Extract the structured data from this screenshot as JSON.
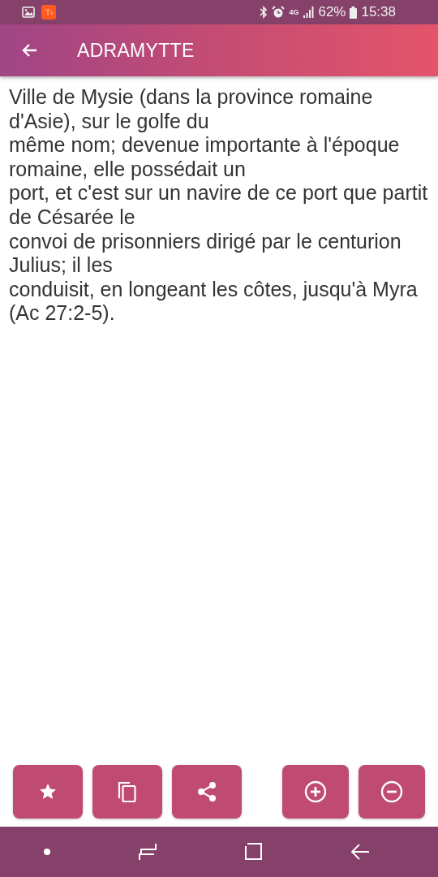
{
  "status_bar": {
    "network": "4G",
    "battery": "62%",
    "time": "15:38"
  },
  "app_bar": {
    "title": "ADRAMYTTE"
  },
  "body": {
    "lines": [
      "Ville de Mysie (dans la province romaine d'Asie), sur le golfe du",
      "même nom; devenue importante à l'époque romaine, elle possédait un",
      "port, et c'est sur un navire de ce port que partit de Césarée le",
      "convoi de prisonniers dirigé par le centurion Julius; il les",
      "conduisit, en longeant les côtes, jusqu'à Myra (Ac 27:2-5)."
    ]
  },
  "actions": [
    {
      "kind": "star"
    },
    {
      "kind": "copy"
    },
    {
      "kind": "share"
    }
  ],
  "zoom_actions": [
    {
      "kind": "zoom-in"
    },
    {
      "kind": "zoom-out"
    }
  ]
}
